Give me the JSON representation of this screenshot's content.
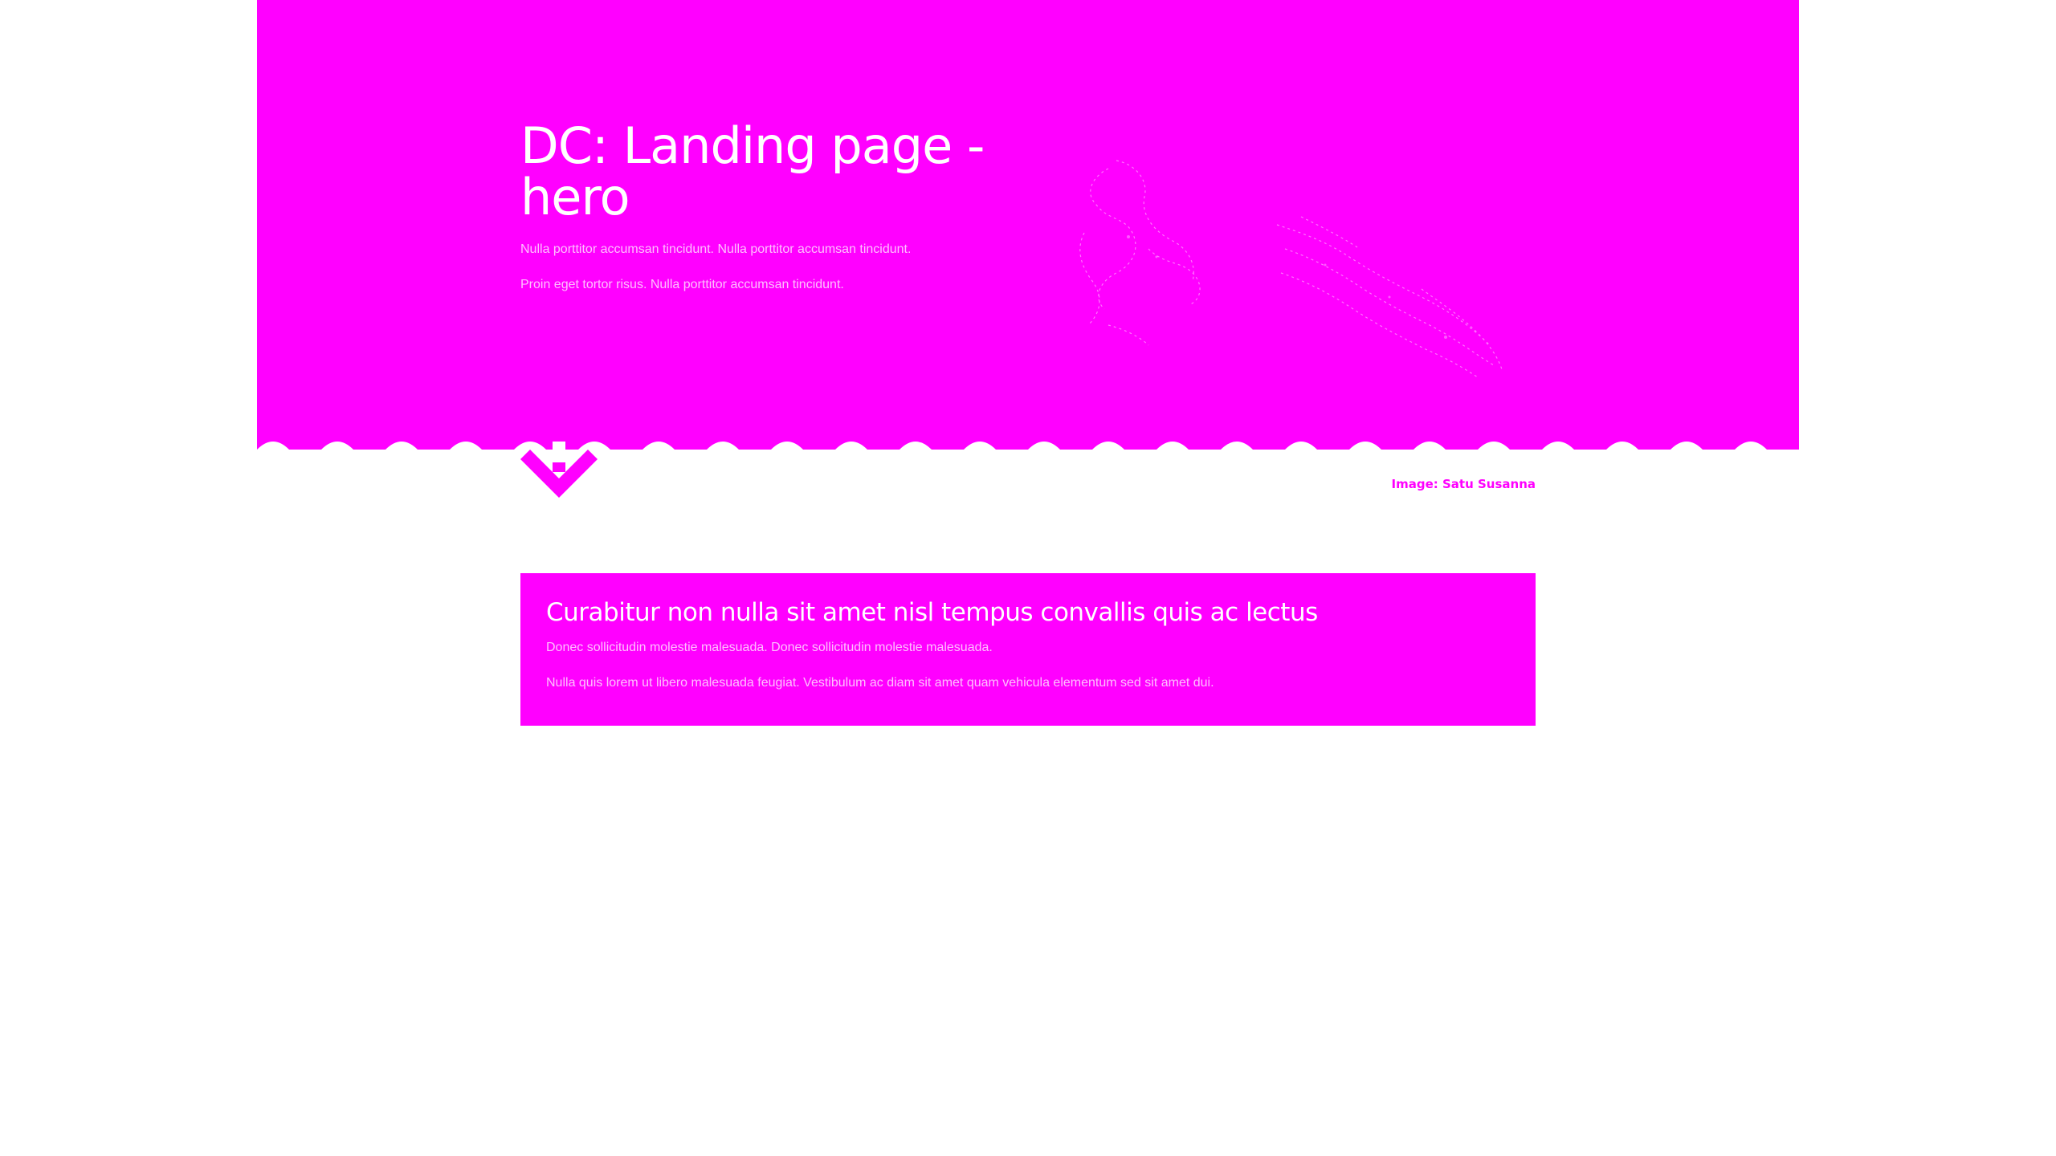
{
  "hero": {
    "title": "DC: Landing page - hero",
    "paragraphs": [
      "Nulla porttitor accumsan tincidunt. Nulla porttitor accumsan tincidunt.",
      "Proin eget tortor risus. Nulla porttitor accumsan tincidunt."
    ],
    "background_color": "#ff00ff",
    "text_color": "#ffffff",
    "image_icon": "pencil-sketch-illustration",
    "scroll_icon": "chevron-down-arrow-icon"
  },
  "image_credit": "Image: Satu Susanna",
  "info_box": {
    "title": "Curabitur non nulla sit amet nisl tempus convallis quis ac lectus",
    "paragraphs": [
      "Donec sollicitudin molestie malesuada. Donec sollicitudin molestie malesuada.",
      "Nulla quis lorem ut libero malesuada feugiat. Vestibulum ac diam sit amet quam vehicula elementum sed sit amet dui."
    ],
    "background_color": "#ff00ff"
  }
}
